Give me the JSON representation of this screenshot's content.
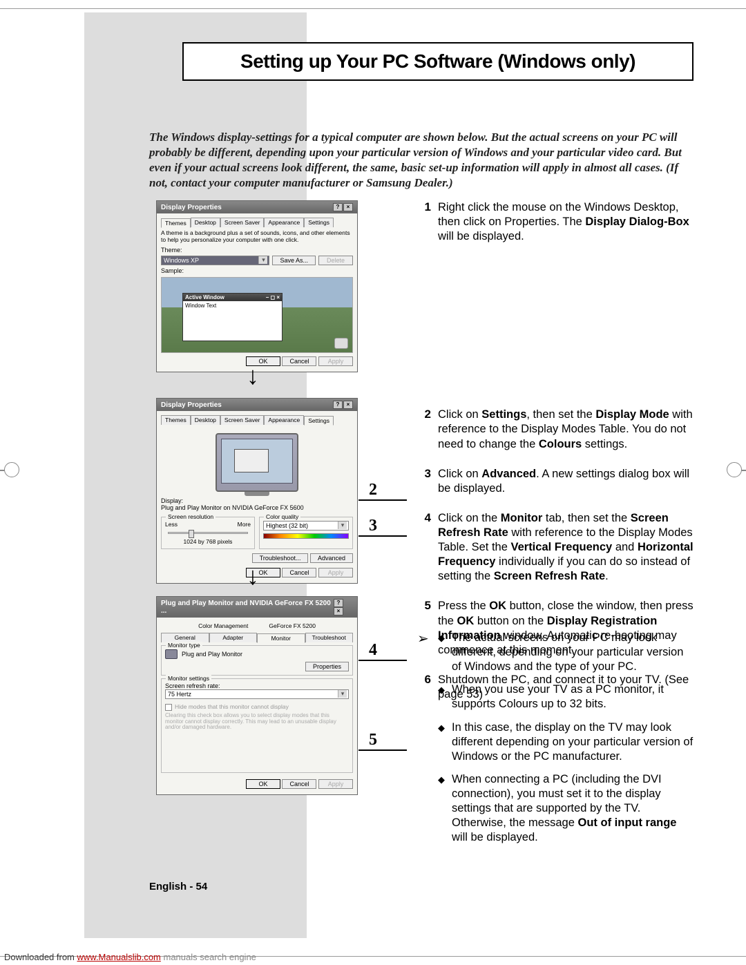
{
  "title": "Setting up Your PC Software (Windows only)",
  "intro": "The Windows display-settings for a typical computer are shown below. But the actual screens on your PC will probably be different, depending upon your particular version of Windows and your particular video card. But even if your actual screens look different, the same, basic set-up information will apply in almost all cases. (If not, contact your computer manufacturer or Samsung Dealer.)",
  "steps": {
    "s1": {
      "n": "1",
      "pre": "Right click the mouse on the Windows Desktop, then click on Properties. The ",
      "b": "Display Dialog-Box",
      "post": " will be displayed."
    },
    "s2": {
      "n": "2",
      "t": "Click on <b>Settings</b>, then set the <b>Display Mode</b> with reference to the Display Modes Table. You do not need to change the <b>Colours</b> settings."
    },
    "s3": {
      "n": "3",
      "t": "Click on <b>Advanced</b>. A new settings dialog box will be displayed."
    },
    "s4": {
      "n": "4",
      "t": "Click on the <b>Monitor</b> tab, then set the <b>Screen Refresh Rate</b> with reference to the Display Modes Table. Set the <b>Vertical Frequency</b> and <b>Horizontal Frequency</b> individually if you can do so instead of setting the <b>Screen Refresh Rate</b>."
    },
    "s5": {
      "n": "5",
      "t": "Press the <b>OK</b> button, close the window, then press the <b>OK</b> button on the <b>Display Registration Information</b> window. Automatic re-booting may commence at this moment."
    },
    "s6": {
      "n": "6",
      "t": "Shutdown the PC, and connect it to your TV. (See page 53)"
    }
  },
  "notes": {
    "n1": "The actual screens on your PC may look different, depending on your particular version of Windows and the type of your PC.",
    "n2": "When you use your TV as a PC monitor, it supports Colours up to 32 bits.",
    "n3": "In this case, the display on the TV may look different depending on your particular version of Windows or the PC manufacturer.",
    "n4": "When connecting a PC (including the DVI connection), you must set it to the display settings that are supported by the TV. Otherwise, the message <b>Out of input range</b> will be displayed."
  },
  "footer": {
    "lang": "English - ",
    "page": "54"
  },
  "download": {
    "pre": "Downloaded from ",
    "link": "www.Manualslib.com",
    "post": " manuals search engine"
  },
  "dlg1": {
    "title": "Display Properties",
    "tabs": [
      "Themes",
      "Desktop",
      "Screen Saver",
      "Appearance",
      "Settings"
    ],
    "desc": "A theme is a background plus a set of sounds, icons, and other elements to help you personalize your computer with one click.",
    "theme_label": "Theme:",
    "theme_value": "Windows XP",
    "save_as": "Save As...",
    "delete": "Delete",
    "sample": "Sample:",
    "active": "Active Window",
    "wintext": "Window Text",
    "ok": "OK",
    "cancel": "Cancel",
    "apply": "Apply"
  },
  "dlg2": {
    "title": "Display Properties",
    "tabs": [
      "Themes",
      "Desktop",
      "Screen Saver",
      "Appearance",
      "Settings"
    ],
    "display": "Display:",
    "display_val": "Plug and Play Monitor on NVIDIA GeForce FX 5600",
    "res_label": "Screen resolution",
    "less": "Less",
    "more": "More",
    "res_val": "1024 by 768 pixels",
    "cq": "Color quality",
    "cq_val": "Highest (32 bit)",
    "troubleshoot": "Troubleshoot...",
    "advanced": "Advanced",
    "ok": "OK",
    "cancel": "Cancel",
    "apply": "Apply"
  },
  "dlg3": {
    "title": "Plug and Play Monitor and NVIDIA GeForce FX 5200 ...",
    "tabs1": [
      "Color Management",
      "GeForce FX 5200"
    ],
    "tabs2": [
      "General",
      "Adapter",
      "Monitor",
      "Troubleshoot"
    ],
    "mtype": "Monitor type",
    "mname": "Plug and Play Monitor",
    "props": "Properties",
    "msettings": "Monitor settings",
    "refresh": "Screen refresh rate:",
    "hz": "75 Hertz",
    "hide": "Hide modes that this monitor cannot display",
    "hint": "Clearing this check box allows you to select display modes that this monitor cannot display correctly. This may lead to an unusable display and/or damaged hardware.",
    "ok": "OK",
    "cancel": "Cancel",
    "apply": "Apply"
  },
  "callouts": {
    "c2": "2",
    "c3": "3",
    "c4": "4",
    "c5": "5"
  }
}
